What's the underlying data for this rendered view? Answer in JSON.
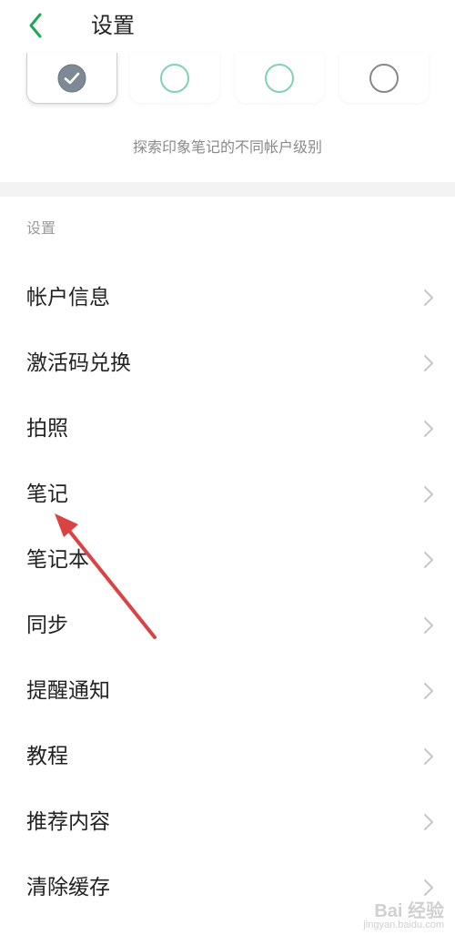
{
  "header": {
    "title": "设置",
    "back_icon": "chevron-left-icon",
    "accent_color": "#1fa855"
  },
  "tiers": {
    "selected_index": 0,
    "items": [
      {
        "icon": "check-circle-icon",
        "selected": true
      },
      {
        "icon": "circle-icon",
        "color": "#7fd3b0"
      },
      {
        "icon": "circle-icon",
        "color": "#7fd3b0"
      },
      {
        "icon": "circle-icon",
        "color": "#888888"
      }
    ],
    "caption": "探索印象笔记的不同帐户级别"
  },
  "settings": {
    "section_label": "设置",
    "items": [
      {
        "label": "帐户信息"
      },
      {
        "label": "激活码兑换"
      },
      {
        "label": "拍照"
      },
      {
        "label": "笔记"
      },
      {
        "label": "笔记本"
      },
      {
        "label": "同步"
      },
      {
        "label": "提醒通知"
      },
      {
        "label": "教程"
      },
      {
        "label": "推荐内容"
      },
      {
        "label": "清除缓存"
      }
    ]
  },
  "annotation": {
    "arrow_color": "#d94343",
    "points_to": "笔记"
  },
  "watermark": {
    "brand": "Bai 经验",
    "url": "jingyan.baidu.com"
  }
}
